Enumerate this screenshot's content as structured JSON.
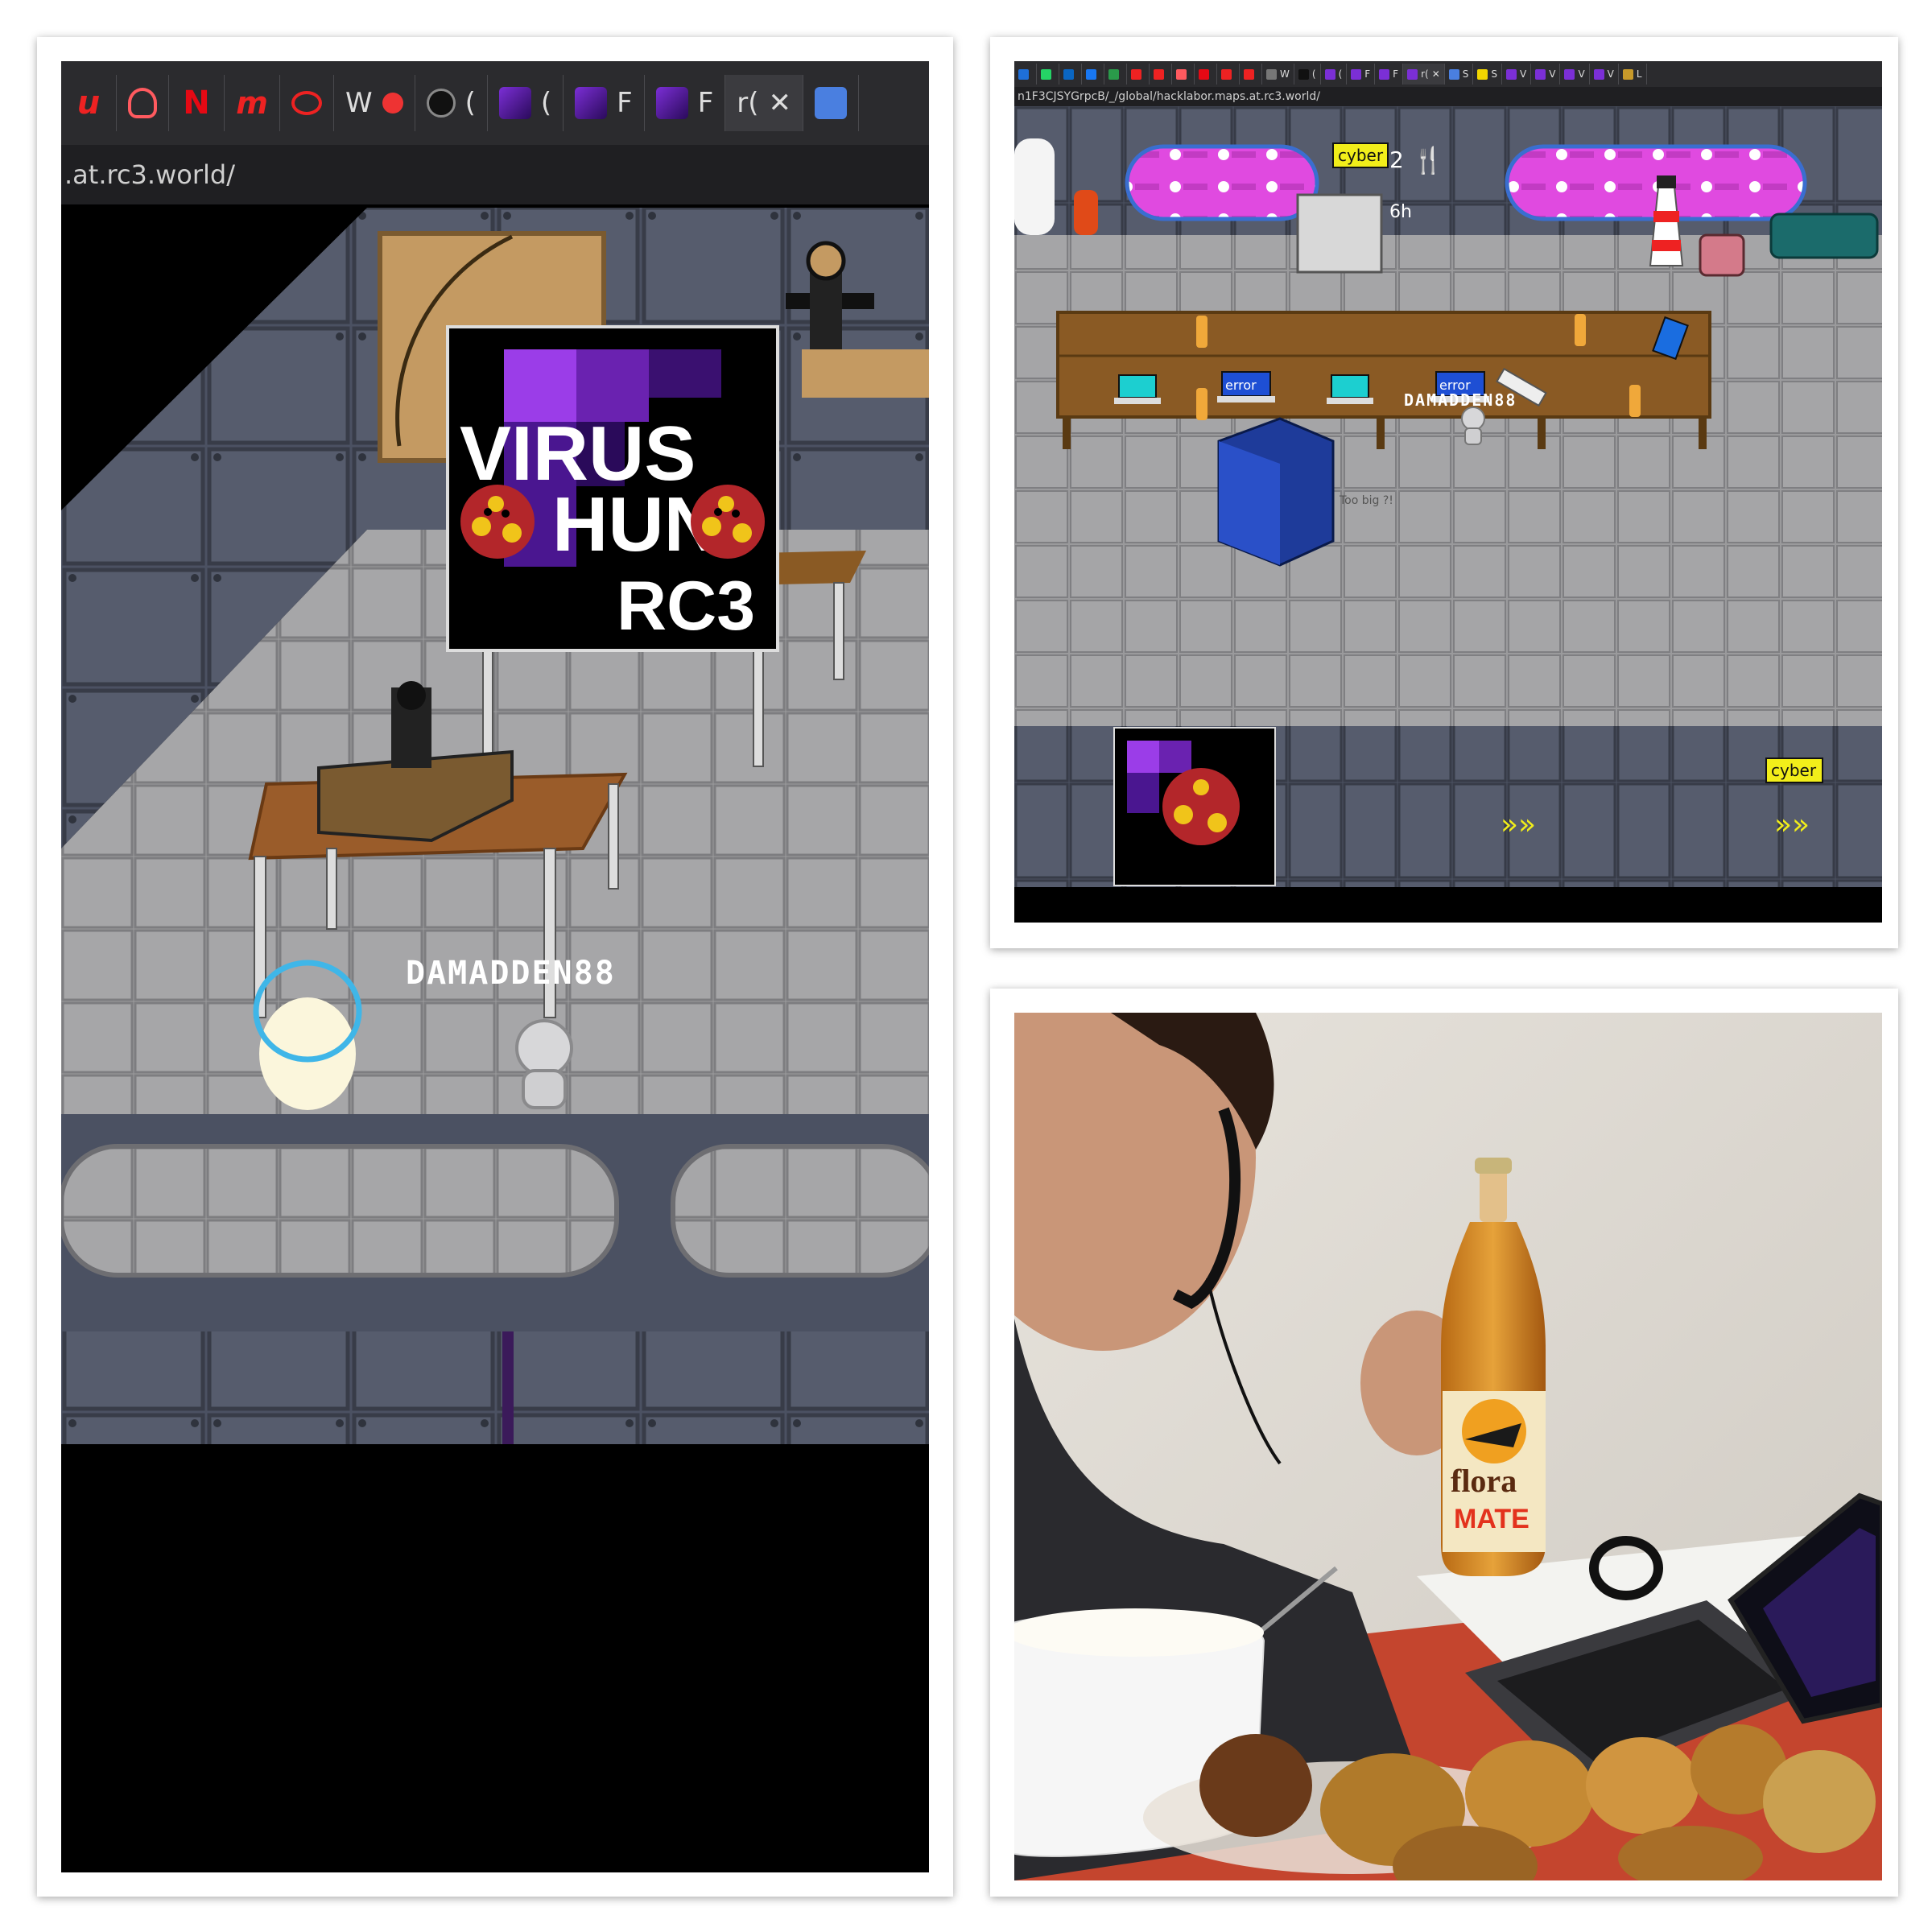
{
  "left_screenshot": {
    "tabs": [
      {
        "icon": "u-icon",
        "label": ""
      },
      {
        "icon": "airbnb-icon",
        "label": ""
      },
      {
        "icon": "netflix-icon",
        "label": ""
      },
      {
        "icon": "m-icon",
        "label": ""
      },
      {
        "icon": "ring-icon",
        "label": ""
      },
      {
        "icon": "w-icon",
        "label": "W"
      },
      {
        "icon": "github-icon",
        "label": "("
      },
      {
        "icon": "rc3-icon",
        "label": "("
      },
      {
        "icon": "rc3-icon",
        "label": "F"
      },
      {
        "icon": "rc3-icon",
        "label": "F"
      }
    ],
    "active_tab_label": "r(",
    "url": ".at.rc3.world/",
    "poster": {
      "line1": "VIRUS",
      "line2": "HUN",
      "line3": "RC3"
    },
    "player_name": "DAMADDEN88"
  },
  "top_right_screenshot": {
    "url": "n1F3CJSYGrpcB/_/global/hacklabor.maps.at.rc3.world/",
    "tabs": [
      {
        "icon": "a-icon",
        "label": ""
      },
      {
        "icon": "whatsapp-icon",
        "label": ""
      },
      {
        "icon": "linkedin-icon",
        "label": ""
      },
      {
        "icon": "facebook-icon",
        "label": ""
      },
      {
        "icon": "refresh-icon",
        "label": ""
      },
      {
        "icon": "opera-icon",
        "label": ""
      },
      {
        "icon": "u-icon",
        "label": ""
      },
      {
        "icon": "airbnb-icon",
        "label": ""
      },
      {
        "icon": "netflix-icon",
        "label": ""
      },
      {
        "icon": "m-icon",
        "label": ""
      },
      {
        "icon": "ring-icon",
        "label": ""
      },
      {
        "icon": "w-icon",
        "label": "W"
      },
      {
        "icon": "github-icon",
        "label": "("
      },
      {
        "icon": "rc3-icon",
        "label": "("
      },
      {
        "icon": "rc3-icon",
        "label": "F"
      },
      {
        "icon": "rc3-icon",
        "label": "F"
      },
      {
        "icon": "rc3-icon",
        "label": "r("
      },
      {
        "icon": "docs-icon",
        "label": "S"
      },
      {
        "icon": "miro-icon",
        "label": "S"
      },
      {
        "icon": "play-icon",
        "label": "V"
      },
      {
        "icon": "play-icon",
        "label": "V"
      },
      {
        "icon": "play-icon",
        "label": "V"
      },
      {
        "icon": "play-icon",
        "label": "V"
      },
      {
        "icon": "image-icon",
        "label": "L"
      }
    ],
    "signs": {
      "cyber_1": "cyber",
      "cyber_2": "cyber",
      "error_1": "error",
      "error_2": "error",
      "time_counter": "2",
      "sleep_counter": "6h"
    },
    "player_name": "DAMADDEN88",
    "server_note": "Too big ?!"
  },
  "photo": {
    "bottle_label_1": "flora",
    "bottle_label_2": "MATE"
  },
  "colors": {
    "floor": "#9a9a9c",
    "wall": "#4b5162",
    "purple": "#7b2fd6",
    "magenta": "#e04ae0",
    "cyber_yellow": "#f2ee1a",
    "error_blue": "#1e4fd4",
    "table_wood": "#8a5a24"
  }
}
